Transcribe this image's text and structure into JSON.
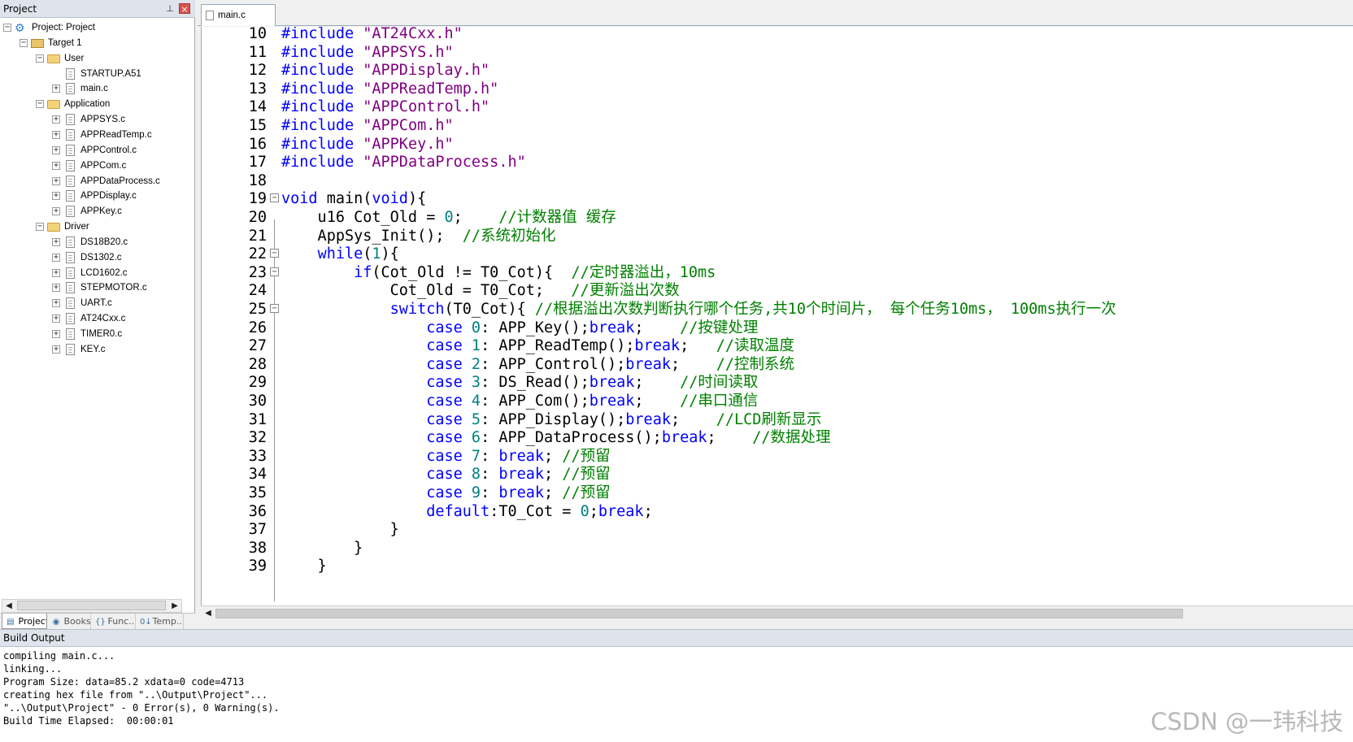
{
  "project_panel": {
    "title": "Project",
    "pin_icon": "pin-icon",
    "close_icon": "close-icon",
    "tree": [
      {
        "label": "Project: Project",
        "icon": "project-icon",
        "expander": "−"
      },
      {
        "label": "Target 1",
        "icon": "target-icon",
        "expander": "−"
      },
      {
        "label": "User",
        "icon": "folder-icon",
        "expander": "−"
      },
      {
        "label": "STARTUP.A51",
        "icon": "file-icon",
        "expander": ""
      },
      {
        "label": "main.c",
        "icon": "file-icon",
        "expander": "+"
      },
      {
        "label": "Application",
        "icon": "folder-icon",
        "expander": "−"
      },
      {
        "label": "APPSYS.c",
        "icon": "file-icon",
        "expander": "+"
      },
      {
        "label": "APPReadTemp.c",
        "icon": "file-icon",
        "expander": "+"
      },
      {
        "label": "APPControl.c",
        "icon": "file-icon",
        "expander": "+"
      },
      {
        "label": "APPCom.c",
        "icon": "file-icon",
        "expander": "+"
      },
      {
        "label": "APPDataProcess.c",
        "icon": "file-icon",
        "expander": "+"
      },
      {
        "label": "APPDisplay.c",
        "icon": "file-icon",
        "expander": "+"
      },
      {
        "label": "APPKey.c",
        "icon": "file-icon",
        "expander": "+"
      },
      {
        "label": "Driver",
        "icon": "folder-icon",
        "expander": "−"
      },
      {
        "label": "DS18B20.c",
        "icon": "file-icon",
        "expander": "+"
      },
      {
        "label": "DS1302.c",
        "icon": "file-icon",
        "expander": "+"
      },
      {
        "label": "LCD1602.c",
        "icon": "file-icon",
        "expander": "+"
      },
      {
        "label": "STEPMOTOR.c",
        "icon": "file-icon",
        "expander": "+"
      },
      {
        "label": "UART.c",
        "icon": "file-icon",
        "expander": "+"
      },
      {
        "label": "AT24Cxx.c",
        "icon": "file-icon",
        "expander": "+"
      },
      {
        "label": "TIMER0.c",
        "icon": "file-icon",
        "expander": "+"
      },
      {
        "label": "KEY.c",
        "icon": "file-icon",
        "expander": "+"
      }
    ],
    "tabs": [
      {
        "label": "Project",
        "icon": "project-tab-icon"
      },
      {
        "label": "Books",
        "icon": "books-icon"
      },
      {
        "label": "Func...",
        "icon": "functions-icon"
      },
      {
        "label": "Temp...",
        "icon": "templates-icon"
      }
    ]
  },
  "editor": {
    "active_tab": "main.c",
    "lines": [
      {
        "n": 10,
        "fold": "",
        "seg": [
          [
            "k",
            "#include"
          ],
          [
            "t",
            " "
          ],
          [
            "s",
            "\"AT24Cxx.h\""
          ]
        ]
      },
      {
        "n": 11,
        "fold": "",
        "seg": [
          [
            "k",
            "#include"
          ],
          [
            "t",
            " "
          ],
          [
            "s",
            "\"APPSYS.h\""
          ]
        ]
      },
      {
        "n": 12,
        "fold": "",
        "seg": [
          [
            "k",
            "#include"
          ],
          [
            "t",
            " "
          ],
          [
            "s",
            "\"APPDisplay.h\""
          ]
        ]
      },
      {
        "n": 13,
        "fold": "",
        "seg": [
          [
            "k",
            "#include"
          ],
          [
            "t",
            " "
          ],
          [
            "s",
            "\"APPReadTemp.h\""
          ]
        ]
      },
      {
        "n": 14,
        "fold": "",
        "seg": [
          [
            "k",
            "#include"
          ],
          [
            "t",
            " "
          ],
          [
            "s",
            "\"APPControl.h\""
          ]
        ]
      },
      {
        "n": 15,
        "fold": "",
        "seg": [
          [
            "k",
            "#include"
          ],
          [
            "t",
            " "
          ],
          [
            "s",
            "\"APPCom.h\""
          ]
        ]
      },
      {
        "n": 16,
        "fold": "",
        "seg": [
          [
            "k",
            "#include"
          ],
          [
            "t",
            " "
          ],
          [
            "s",
            "\"APPKey.h\""
          ]
        ]
      },
      {
        "n": 17,
        "fold": "",
        "seg": [
          [
            "k",
            "#include"
          ],
          [
            "t",
            " "
          ],
          [
            "s",
            "\"APPDataProcess.h\""
          ]
        ]
      },
      {
        "n": 18,
        "fold": "",
        "seg": []
      },
      {
        "n": 19,
        "fold": "−",
        "seg": [
          [
            "k",
            "void"
          ],
          [
            "t",
            " main("
          ],
          [
            "k",
            "void"
          ],
          [
            "t",
            "){"
          ]
        ]
      },
      {
        "n": 20,
        "fold": "",
        "seg": [
          [
            "t",
            "    u16 Cot_Old = "
          ],
          [
            "n",
            "0"
          ],
          [
            "t",
            ";    "
          ],
          [
            "c",
            "//计数器值 缓存"
          ]
        ]
      },
      {
        "n": 21,
        "fold": "",
        "seg": [
          [
            "t",
            "    AppSys_Init();  "
          ],
          [
            "c",
            "//系统初始化"
          ]
        ]
      },
      {
        "n": 22,
        "fold": "−",
        "seg": [
          [
            "t",
            "    "
          ],
          [
            "k",
            "while"
          ],
          [
            "t",
            "("
          ],
          [
            "n",
            "1"
          ],
          [
            "t",
            "){"
          ]
        ]
      },
      {
        "n": 23,
        "fold": "−",
        "seg": [
          [
            "t",
            "        "
          ],
          [
            "k",
            "if"
          ],
          [
            "t",
            "(Cot_Old != T0_Cot){  "
          ],
          [
            "c",
            "//定时器溢出，10ms"
          ]
        ]
      },
      {
        "n": 24,
        "fold": "",
        "seg": [
          [
            "t",
            "            Cot_Old = T0_Cot;   "
          ],
          [
            "c",
            "//更新溢出次数"
          ]
        ]
      },
      {
        "n": 25,
        "fold": "−",
        "seg": [
          [
            "t",
            "            "
          ],
          [
            "k",
            "switch"
          ],
          [
            "t",
            "(T0_Cot){ "
          ],
          [
            "c",
            "//根据溢出次数判断执行哪个任务,共10个时间片， 每个任务10ms， 100ms执行一次"
          ]
        ]
      },
      {
        "n": 26,
        "fold": "",
        "seg": [
          [
            "t",
            "                "
          ],
          [
            "k",
            "case"
          ],
          [
            "t",
            " "
          ],
          [
            "n",
            "0"
          ],
          [
            "t",
            ": APP_Key();"
          ],
          [
            "k",
            "break"
          ],
          [
            "t",
            ";    "
          ],
          [
            "c",
            "//按键处理"
          ]
        ]
      },
      {
        "n": 27,
        "fold": "",
        "seg": [
          [
            "t",
            "                "
          ],
          [
            "k",
            "case"
          ],
          [
            "t",
            " "
          ],
          [
            "n",
            "1"
          ],
          [
            "t",
            ": APP_ReadTemp();"
          ],
          [
            "k",
            "break"
          ],
          [
            "t",
            ";   "
          ],
          [
            "c",
            "//读取温度"
          ]
        ]
      },
      {
        "n": 28,
        "fold": "",
        "seg": [
          [
            "t",
            "                "
          ],
          [
            "k",
            "case"
          ],
          [
            "t",
            " "
          ],
          [
            "n",
            "2"
          ],
          [
            "t",
            ": APP_Control();"
          ],
          [
            "k",
            "break"
          ],
          [
            "t",
            ";    "
          ],
          [
            "c",
            "//控制系统"
          ]
        ]
      },
      {
        "n": 29,
        "fold": "",
        "seg": [
          [
            "t",
            "                "
          ],
          [
            "k",
            "case"
          ],
          [
            "t",
            " "
          ],
          [
            "n",
            "3"
          ],
          [
            "t",
            ": DS_Read();"
          ],
          [
            "k",
            "break"
          ],
          [
            "t",
            ";    "
          ],
          [
            "c",
            "//时间读取"
          ]
        ]
      },
      {
        "n": 30,
        "fold": "",
        "seg": [
          [
            "t",
            "                "
          ],
          [
            "k",
            "case"
          ],
          [
            "t",
            " "
          ],
          [
            "n",
            "4"
          ],
          [
            "t",
            ": APP_Com();"
          ],
          [
            "k",
            "break"
          ],
          [
            "t",
            ";    "
          ],
          [
            "c",
            "//串口通信"
          ]
        ]
      },
      {
        "n": 31,
        "fold": "",
        "seg": [
          [
            "t",
            "                "
          ],
          [
            "k",
            "case"
          ],
          [
            "t",
            " "
          ],
          [
            "n",
            "5"
          ],
          [
            "t",
            ": APP_Display();"
          ],
          [
            "k",
            "break"
          ],
          [
            "t",
            ";    "
          ],
          [
            "c",
            "//LCD刷新显示"
          ]
        ]
      },
      {
        "n": 32,
        "fold": "",
        "seg": [
          [
            "t",
            "                "
          ],
          [
            "k",
            "case"
          ],
          [
            "t",
            " "
          ],
          [
            "n",
            "6"
          ],
          [
            "t",
            ": APP_DataProcess();"
          ],
          [
            "k",
            "break"
          ],
          [
            "t",
            ";    "
          ],
          [
            "c",
            "//数据处理"
          ]
        ]
      },
      {
        "n": 33,
        "fold": "",
        "seg": [
          [
            "t",
            "                "
          ],
          [
            "k",
            "case"
          ],
          [
            "t",
            " "
          ],
          [
            "n",
            "7"
          ],
          [
            "t",
            ": "
          ],
          [
            "k",
            "break"
          ],
          [
            "t",
            "; "
          ],
          [
            "c",
            "//预留"
          ]
        ]
      },
      {
        "n": 34,
        "fold": "",
        "seg": [
          [
            "t",
            "                "
          ],
          [
            "k",
            "case"
          ],
          [
            "t",
            " "
          ],
          [
            "n",
            "8"
          ],
          [
            "t",
            ": "
          ],
          [
            "k",
            "break"
          ],
          [
            "t",
            "; "
          ],
          [
            "c",
            "//预留"
          ]
        ]
      },
      {
        "n": 35,
        "fold": "",
        "seg": [
          [
            "t",
            "                "
          ],
          [
            "k",
            "case"
          ],
          [
            "t",
            " "
          ],
          [
            "n",
            "9"
          ],
          [
            "t",
            ": "
          ],
          [
            "k",
            "break"
          ],
          [
            "t",
            "; "
          ],
          [
            "c",
            "//预留"
          ]
        ]
      },
      {
        "n": 36,
        "fold": "",
        "seg": [
          [
            "t",
            "                "
          ],
          [
            "k",
            "default"
          ],
          [
            "t",
            ":T0_Cot = "
          ],
          [
            "n",
            "0"
          ],
          [
            "t",
            ";"
          ],
          [
            "k",
            "break"
          ],
          [
            "t",
            ";"
          ]
        ]
      },
      {
        "n": 37,
        "fold": "",
        "seg": [
          [
            "t",
            "            }"
          ]
        ]
      },
      {
        "n": 38,
        "fold": "",
        "seg": [
          [
            "t",
            "        }"
          ]
        ]
      },
      {
        "n": 39,
        "fold": "",
        "seg": [
          [
            "t",
            "    }"
          ]
        ]
      }
    ]
  },
  "build_output": {
    "title": "Build Output",
    "lines": [
      "compiling main.c...",
      "linking...",
      "Program Size: data=85.2 xdata=0 code=4713",
      "creating hex file from \"..\\Output\\Project\"...",
      "\"..\\Output\\Project\" - 0 Error(s), 0 Warning(s).",
      "Build Time Elapsed:  00:00:01"
    ]
  },
  "watermark": "CSDN @一玮科技",
  "colors": {
    "keyword": "#0000ff",
    "string": "#800080",
    "comment": "#008000",
    "number": "#008080",
    "header_bg": "#dfe4ec"
  }
}
